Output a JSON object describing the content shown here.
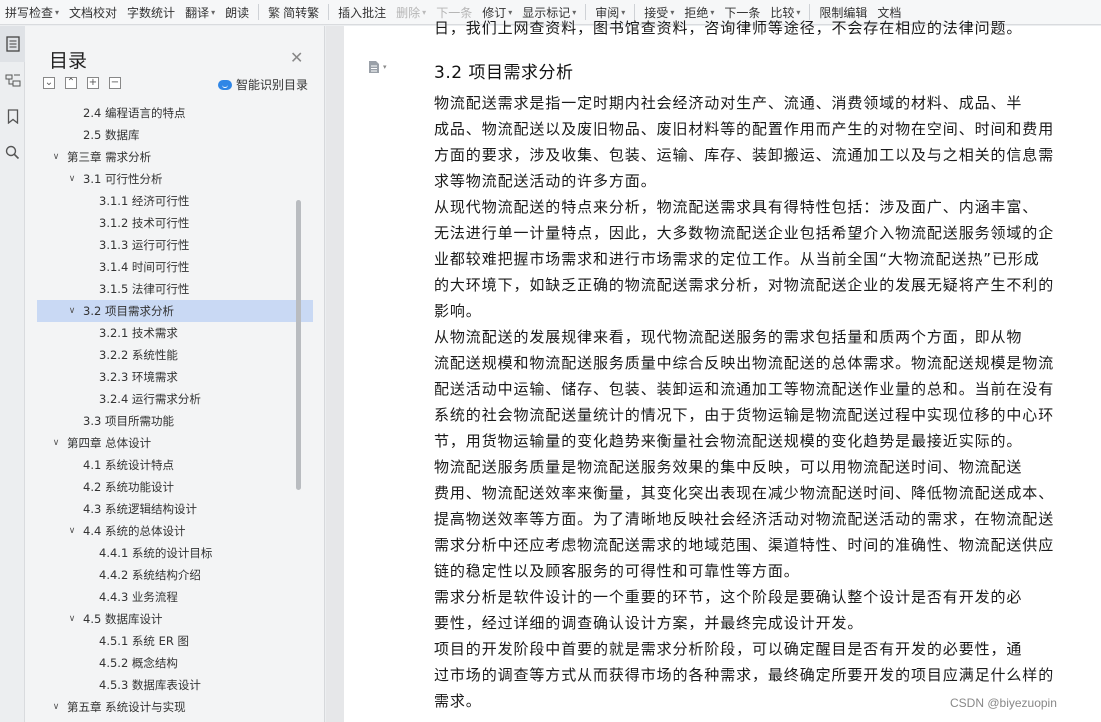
{
  "toolbar": {
    "items": [
      {
        "label": "拼写检查",
        "caret": true
      },
      {
        "label": "文档校对"
      },
      {
        "label": "字数统计"
      },
      {
        "label": "翻译",
        "caret": true
      },
      {
        "label": "朗读"
      },
      {
        "label": "简转繁",
        "icon": "繁"
      },
      {
        "label": "插入批注"
      },
      {
        "label": "删除",
        "caret": true,
        "disabled": true
      },
      {
        "label": "下一条",
        "disabled": true
      },
      {
        "label": "修订",
        "caret": true
      },
      {
        "label": "显示标记",
        "caret": true
      },
      {
        "label": "审阅",
        "caret": true
      },
      {
        "label": "接受",
        "caret": true
      },
      {
        "label": "拒绝",
        "caret": true
      },
      {
        "label": "下一条"
      },
      {
        "label": "比较",
        "caret": true
      },
      {
        "label": "限制编辑"
      },
      {
        "label": "文档"
      }
    ]
  },
  "toc": {
    "title": "目录",
    "smart_label": "智能识别目录",
    "ctrl_labels": [
      "⌄",
      "⌃",
      "+",
      "−"
    ],
    "items": [
      {
        "label": "2.4 编程语言的特点",
        "level": 2
      },
      {
        "label": "2.5  数据库",
        "level": 2
      },
      {
        "label": "第三章  需求分析",
        "level": 1,
        "expanded": true
      },
      {
        "label": "3.1  可行性分析",
        "level": 2,
        "expanded": true
      },
      {
        "label": "3.1.1  经济可行性",
        "level": 3
      },
      {
        "label": "3.1.2  技术可行性",
        "level": 3
      },
      {
        "label": "3.1.3  运行可行性",
        "level": 3
      },
      {
        "label": "3.1.4  时间可行性",
        "level": 3
      },
      {
        "label": "3.1.5  法律可行性",
        "level": 3
      },
      {
        "label": "3.2  项目需求分析",
        "level": 2,
        "expanded": true,
        "selected": true
      },
      {
        "label": "3.2.1  技术需求",
        "level": 3
      },
      {
        "label": "3.2.2  系统性能",
        "level": 3
      },
      {
        "label": "3.2.3  环境需求",
        "level": 3
      },
      {
        "label": "3.2.4  运行需求分析",
        "level": 3
      },
      {
        "label": "3.3  项目所需功能",
        "level": 2
      },
      {
        "label": "第四章  总体设计",
        "level": 1,
        "expanded": true
      },
      {
        "label": "4.1 系统设计特点",
        "level": 2
      },
      {
        "label": "4.2 系统功能设计",
        "level": 2
      },
      {
        "label": "4.3 系统逻辑结构设计",
        "level": 2
      },
      {
        "label": "4.4 系统的总体设计",
        "level": 2,
        "expanded": true
      },
      {
        "label": "4.4.1 系统的设计目标",
        "level": 3
      },
      {
        "label": "4.4.2 系统结构介绍",
        "level": 3
      },
      {
        "label": "4.4.3 业务流程",
        "level": 3
      },
      {
        "label": "4.5  数据库设计",
        "level": 2,
        "expanded": true
      },
      {
        "label": "4.5.1 系统 ER 图",
        "level": 3
      },
      {
        "label": "4.5.2  概念结构",
        "level": 3
      },
      {
        "label": "4.5.3  数据库表设计",
        "level": 3
      },
      {
        "label": "第五章  系统设计与实现",
        "level": 1,
        "expanded": true
      }
    ]
  },
  "document": {
    "top_line": "日，我们上网查资料，图书馆查资料，咨询律师等途径，不会存在相应的法律问题。",
    "heading": "3.2  项目需求分析",
    "lines": [
      "      物流配送需求是指一定时期内社会经济动对生产、流通、消费领域的材料、成品、半",
      "成品、物流配送以及废旧物品、废旧材料等的配置作用而产生的对物在空间、时间和费用",
      "方面的要求，涉及收集、包装、运输、库存、装卸搬运、流通加工以及与之相关的信息需",
      "求等物流配送活动的许多方面。",
      "      从现代物流配送的特点来分析，物流配送需求具有得特性包括：涉及面广、内涵丰富、",
      "无法进行单一计量特点，因此，大多数物流配送企业包括希望介入物流配送服务领域的企",
      "业都较难把握市场需求和进行市场需求的定位工作。从当前全国“大物流配送热”已形成",
      "的大环境下，如缺乏正确的物流配送需求分析，对物流配送企业的发展无疑将产生不利的",
      "影响。",
      "      从物流配送的发展规律来看，现代物流配送服务的需求包括量和质两个方面，即从物",
      "流配送规模和物流配送服务质量中综合反映出物流配送的总体需求。物流配送规模是物流",
      "配送活动中运输、储存、包装、装卸运和流通加工等物流配送作业量的总和。当前在没有",
      "系统的社会物流配送量统计的情况下，由于货物运输是物流配送过程中实现位移的中心环",
      "节，用货物运输量的变化趋势来衡量社会物流配送规模的变化趋势是最接近实际的。",
      "      物流配送服务质量是物流配送服务效果的集中反映，可以用物流配送时间、物流配送",
      "费用、物流配送效率来衡量，其变化突出表现在减少物流配送时间、降低物流配送成本、",
      "提高物送效率等方面。为了清晰地反映社会经济活动对物流配送活动的需求，在物流配送",
      "需求分析中还应考虑物流配送需求的地域范围、渠道特性、时间的准确性、物流配送供应",
      "链的稳定性以及顾客服务的可得性和可靠性等方面。",
      "      需求分析是软件设计的一个重要的环节，这个阶段是要确认整个设计是否有开发的必",
      "要性，经过详细的调查确认设计方案，并最终完成设计开发。",
      "      项目的开发阶段中首要的就是需求分析阶段，可以确定醒目是否有开发的必要性，通",
      "过市场的调查等方式从而获得市场的各种需求，最终确定所要开发的项目应满足什么样的",
      "需求。"
    ]
  },
  "watermark": "CSDN @biyezuopin",
  "colors": {
    "selected_row": "#c9d9f4",
    "accent": "#2f86e6"
  }
}
